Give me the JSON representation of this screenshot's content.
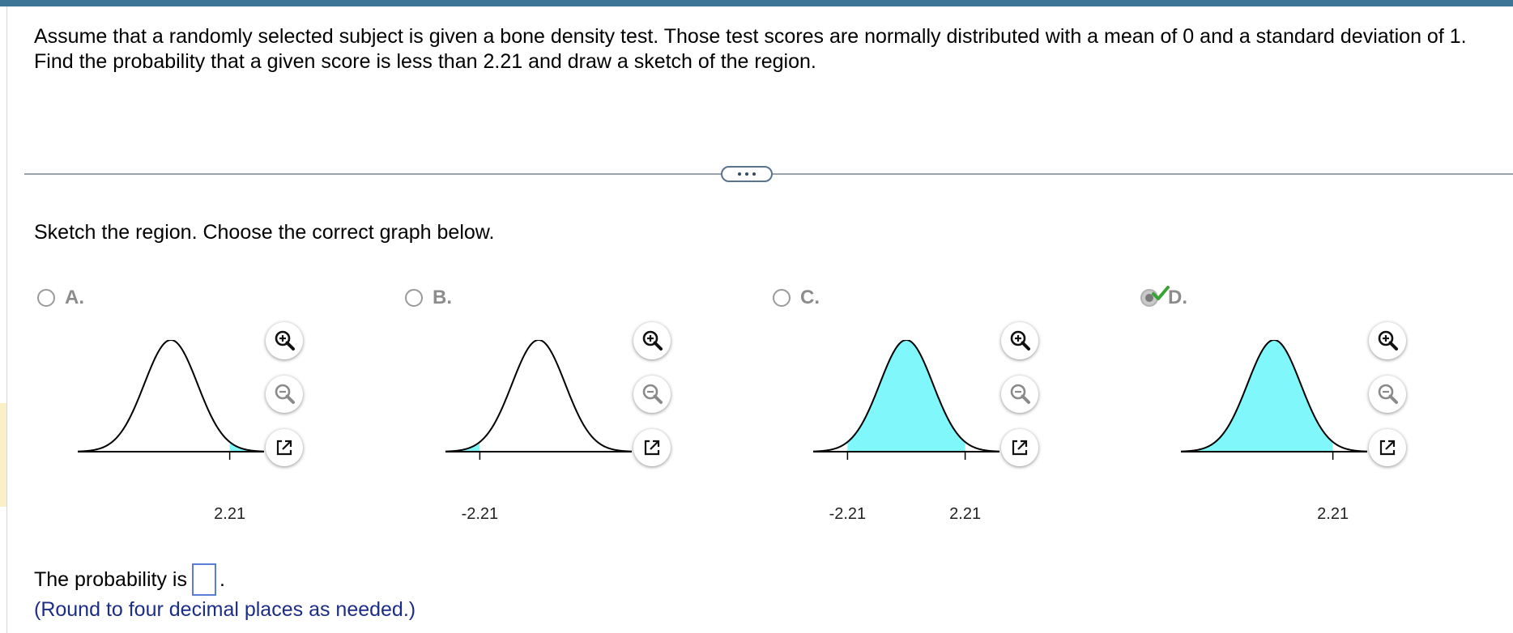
{
  "question": {
    "text": "Assume that a randomly selected subject is given a bone density test. Those test scores are normally distributed with a mean of 0 and a standard deviation of 1. Find the probability that a given score is less than 2.21 and draw a sketch of the region."
  },
  "more_button": {
    "icon": "ellipsis-icon"
  },
  "instruction": "Sketch the region. Choose the correct graph below.",
  "options": [
    {
      "letter": "A.",
      "selected": false,
      "shade": "right",
      "ticks": [
        {
          "value": 2.21,
          "label": "2.21"
        }
      ]
    },
    {
      "letter": "B.",
      "selected": false,
      "shade": "left",
      "ticks": [
        {
          "value": -2.21,
          "label": "-2.21"
        }
      ]
    },
    {
      "letter": "C.",
      "selected": false,
      "shade": "between",
      "ticks": [
        {
          "value": -2.21,
          "label": "-2.21"
        },
        {
          "value": 2.21,
          "label": "2.21"
        }
      ]
    },
    {
      "letter": "D.",
      "selected": true,
      "correct_mark": true,
      "shade": "below",
      "ticks": [
        {
          "value": 2.21,
          "label": "2.21"
        }
      ]
    }
  ],
  "graph_style": {
    "fill": "#7ff7fb",
    "stroke": "#000000",
    "xlim": [
      -3.5,
      3.5
    ]
  },
  "tools": {
    "zoom_in": "zoom-in-icon",
    "zoom_out": "zoom-out-icon",
    "popout": "popout-icon"
  },
  "answer": {
    "prefix": "The probability is",
    "value": "",
    "suffix": "."
  },
  "hint": "(Round to four decimal places as needed.)",
  "colors": {
    "topbar": "#3d7597",
    "hint": "#1b2d86",
    "check": "#3aa335",
    "input_border": "#5b7dd8"
  }
}
